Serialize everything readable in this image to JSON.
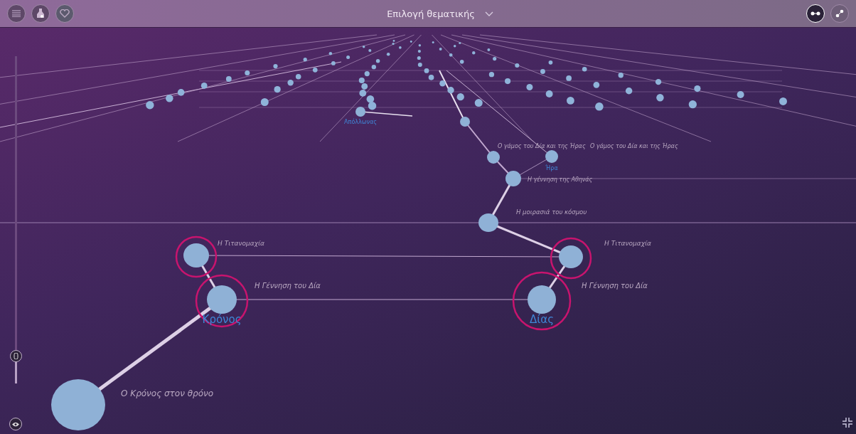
{
  "toolbar": {
    "title": "Επιλογή θεματικής",
    "view_modes": [
      {
        "selected": true
      },
      {
        "selected": false
      }
    ]
  },
  "zoom_slider": {
    "level": 0.08
  },
  "nodes": [
    {
      "name": "Απόλλωνας",
      "highlighted": false
    },
    {
      "highlighted": false
    },
    {
      "title": "Ο γάμος του Δία και της Ήρας",
      "highlighted": false
    },
    {
      "title": "Ο γάμος του Δία και της Ήρας",
      "name": "Ήρα",
      "highlighted": false
    },
    {
      "title": "Η γέννηση της Αθηνάς",
      "highlighted": false
    },
    {
      "title": "Η μοιρασιά του κόσμου",
      "highlighted": false
    },
    {
      "title": "Η Τιτανομαχία",
      "highlighted": true
    },
    {
      "title": "Η Τιτανομαχία",
      "highlighted": true
    },
    {
      "title": "Η Γέννηση του Δία",
      "name": "Κρόνος",
      "highlighted": true
    },
    {
      "title": "Η Γέννηση του Δία",
      "name": "Δίας",
      "highlighted": true
    },
    {
      "title": "Ο Κρόνος στον θρόνο",
      "highlighted": false
    }
  ]
}
